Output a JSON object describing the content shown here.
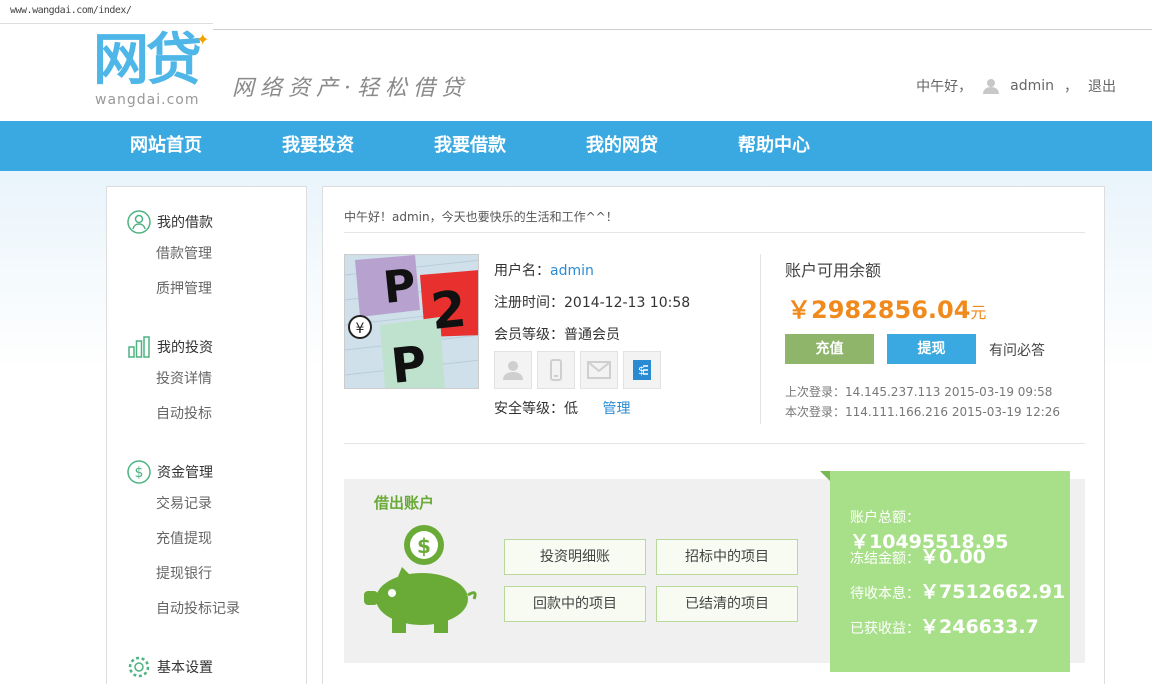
{
  "browser": {
    "url": "www.wangdai.com/index/"
  },
  "header": {
    "logo_text": "网贷",
    "logo_sub": "wangdai.com",
    "slogan": "网络资产·轻松借贷",
    "greeting": "中午好，",
    "username": "admin",
    "comma": "，",
    "logout": "退出"
  },
  "nav": [
    "网站首页",
    "我要投资",
    "我要借款",
    "我的网贷",
    "帮助中心"
  ],
  "sidebar": {
    "groups": [
      {
        "title": "我的借款",
        "icon": "user-icon",
        "items": [
          "借款管理",
          "质押管理"
        ]
      },
      {
        "title": "我的投资",
        "icon": "bar-chart-icon",
        "items": [
          "投资详情",
          "自动投标"
        ]
      },
      {
        "title": "资金管理",
        "icon": "dollar-icon",
        "items": [
          "交易记录",
          "充值提现",
          "提现银行",
          "自动投标记录"
        ]
      },
      {
        "title": "基本设置",
        "icon": "gear-icon",
        "items": []
      }
    ]
  },
  "main": {
    "greeting": "中午好！admin，今天也要快乐的生活和工作^^！",
    "username_label": "用户名：",
    "username_value": "admin",
    "register_label": "注册时间：",
    "register_value": "2014-12-13 10:58",
    "level_label": "会员等级：",
    "level_value": "普通会员",
    "security_label": "安全等级：",
    "security_value": "低",
    "manage_link": "管理",
    "balance_label": "账户可用余额",
    "balance_value": "￥2982856.04",
    "balance_unit": "元",
    "recharge_button": "充值",
    "withdraw_button": "提现",
    "faq_link": "有问必答",
    "last_login": "上次登录：14.145.237.113  2015-03-19 09:58",
    "this_login": "本次登录：114.111.166.216  2015-03-19 12:26",
    "avatar_text": {
      "p1": "P",
      "two": "2",
      "p2": "P",
      "yen": "¥"
    }
  },
  "lending": {
    "title": "借出账户",
    "buttons": [
      "投资明细账",
      "招标中的项目",
      "回款中的项目",
      "已结清的项目"
    ],
    "stats": [
      {
        "label": "账户总额：",
        "value": "￥10495518.95"
      },
      {
        "label": "冻结金额：",
        "value": "￥0.00"
      },
      {
        "label": "待收本息：",
        "value": "￥7512662.91"
      },
      {
        "label": "已获收益：",
        "value": "￥246633.7"
      }
    ]
  },
  "colors": {
    "nav": "#3aa9e2",
    "accent_orange": "#f08a1d",
    "green": "#8fb56a",
    "lend_green": "#a8e08a"
  }
}
